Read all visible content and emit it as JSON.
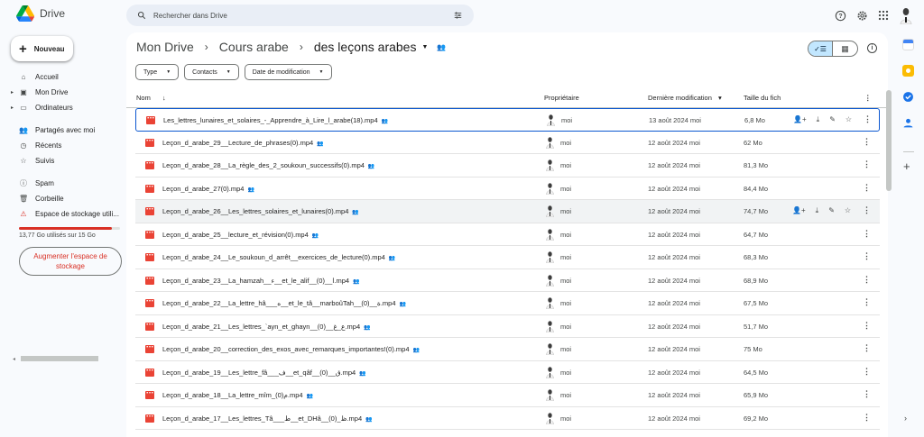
{
  "app": {
    "name": "Drive"
  },
  "search": {
    "placeholder": "Rechercher dans Drive"
  },
  "sidebar": {
    "new_label": "Nouveau",
    "items": [
      {
        "label": "Accueil",
        "icon": "home-icon"
      },
      {
        "label": "Mon Drive",
        "icon": "my-drive-icon"
      },
      {
        "label": "Ordinateurs",
        "icon": "computer-icon"
      },
      {
        "label": "Partagés avec moi",
        "icon": "people-icon"
      },
      {
        "label": "Récents",
        "icon": "clock-icon"
      },
      {
        "label": "Suivis",
        "icon": "star-icon"
      },
      {
        "label": "Spam",
        "icon": "spam-icon"
      },
      {
        "label": "Corbeille",
        "icon": "trash-icon"
      },
      {
        "label": "Espace de stockage utili...",
        "icon": "warning-icon"
      }
    ],
    "storage_text": "13,77 Go utilisés sur 15 Go",
    "storage_used_fraction": 0.918,
    "upgrade_label": "Augmenter l'espace de stockage"
  },
  "breadcrumb": {
    "root": "Mon Drive",
    "parent": "Cours arabe",
    "current": "des leçons arabes"
  },
  "filters": [
    "Type",
    "Contacts",
    "Date de modification"
  ],
  "columns": {
    "name": "Nom",
    "owner": "Propriétaire",
    "modified": "Dernière modification",
    "size": "Taille du fich"
  },
  "files": [
    {
      "name": "Les_lettres_lunaires_et_solaires_-_Apprendre_à_Lire_l_arabe(18).mp4",
      "owner": "moi",
      "date": "13 août 2024 moi",
      "size": "6,8 Mo"
    },
    {
      "name": "Leçon_d_arabe_29__Lecture_de_phrases(0).mp4",
      "owner": "moi",
      "date": "12 août 2024 moi",
      "size": "62 Mo"
    },
    {
      "name": "Leçon_d_arabe_28__La_règle_des_2_soukoun_successifs(0).mp4",
      "owner": "moi",
      "date": "12 août 2024 moi",
      "size": "81,3 Mo"
    },
    {
      "name": "Leçon_d_arabe_27(0).mp4",
      "owner": "moi",
      "date": "12 août 2024 moi",
      "size": "84,4 Mo"
    },
    {
      "name": "Leçon_d_arabe_26__Les_lettres_solaires_et_lunaires(0).mp4",
      "owner": "moi",
      "date": "12 août 2024 moi",
      "size": "74,7 Mo"
    },
    {
      "name": "Leçon_d_arabe_25__lecture_et_révision(0).mp4",
      "owner": "moi",
      "date": "12 août 2024 moi",
      "size": "64,7 Mo"
    },
    {
      "name": "Leçon_d_arabe_24__Le_soukoun_d_arrêt__exercices_de_lecture(0).mp4",
      "owner": "moi",
      "date": "12 août 2024 moi",
      "size": "68,3 Mo"
    },
    {
      "name": "Leçon_d_arabe_23__La_hamzah__ء__et_le_alif__(0)__ا.mp4",
      "owner": "moi",
      "date": "12 août 2024 moi",
      "size": "68,9 Mo"
    },
    {
      "name": "Leçon_d_arabe_22__La_lettre_hâ___ه__et_le_tâ__marboûTah__(0)__ة.mp4",
      "owner": "moi",
      "date": "12 août 2024 moi",
      "size": "67,5 Mo"
    },
    {
      "name": "Leçon_d_arabe_21__Les_lettres_`ayn_et_ghayn__(0)__ع_غ.mp4",
      "owner": "moi",
      "date": "12 août 2024 moi",
      "size": "51,7 Mo"
    },
    {
      "name": "Leçon_d_arabe_20__correction_des_exos_avec_remarques_importantes!(0).mp4",
      "owner": "moi",
      "date": "12 août 2024 moi",
      "size": "75 Mo"
    },
    {
      "name": "Leçon_d_arabe_19__Les_lettre_fâ___ف__et_qâf__(0)__ق.mp4",
      "owner": "moi",
      "date": "12 août 2024 moi",
      "size": "64,5 Mo"
    },
    {
      "name": "Leçon_d_arabe_18__La_lettre_mîm_(0)م.mp4",
      "owner": "moi",
      "date": "12 août 2024 moi",
      "size": "65,9 Mo"
    },
    {
      "name": "Leçon_d_arabe_17__Les_lettres_Tâ___ط__et_DHâ__(0)_ظ.mp4",
      "owner": "moi",
      "date": "12 août 2024 moi",
      "size": "69,2 Mo"
    }
  ],
  "colors": {
    "accent": "#0b57d0",
    "video_icon": "#ea4335",
    "warning": "#d93025",
    "view_selected": "#c2e7ff"
  }
}
